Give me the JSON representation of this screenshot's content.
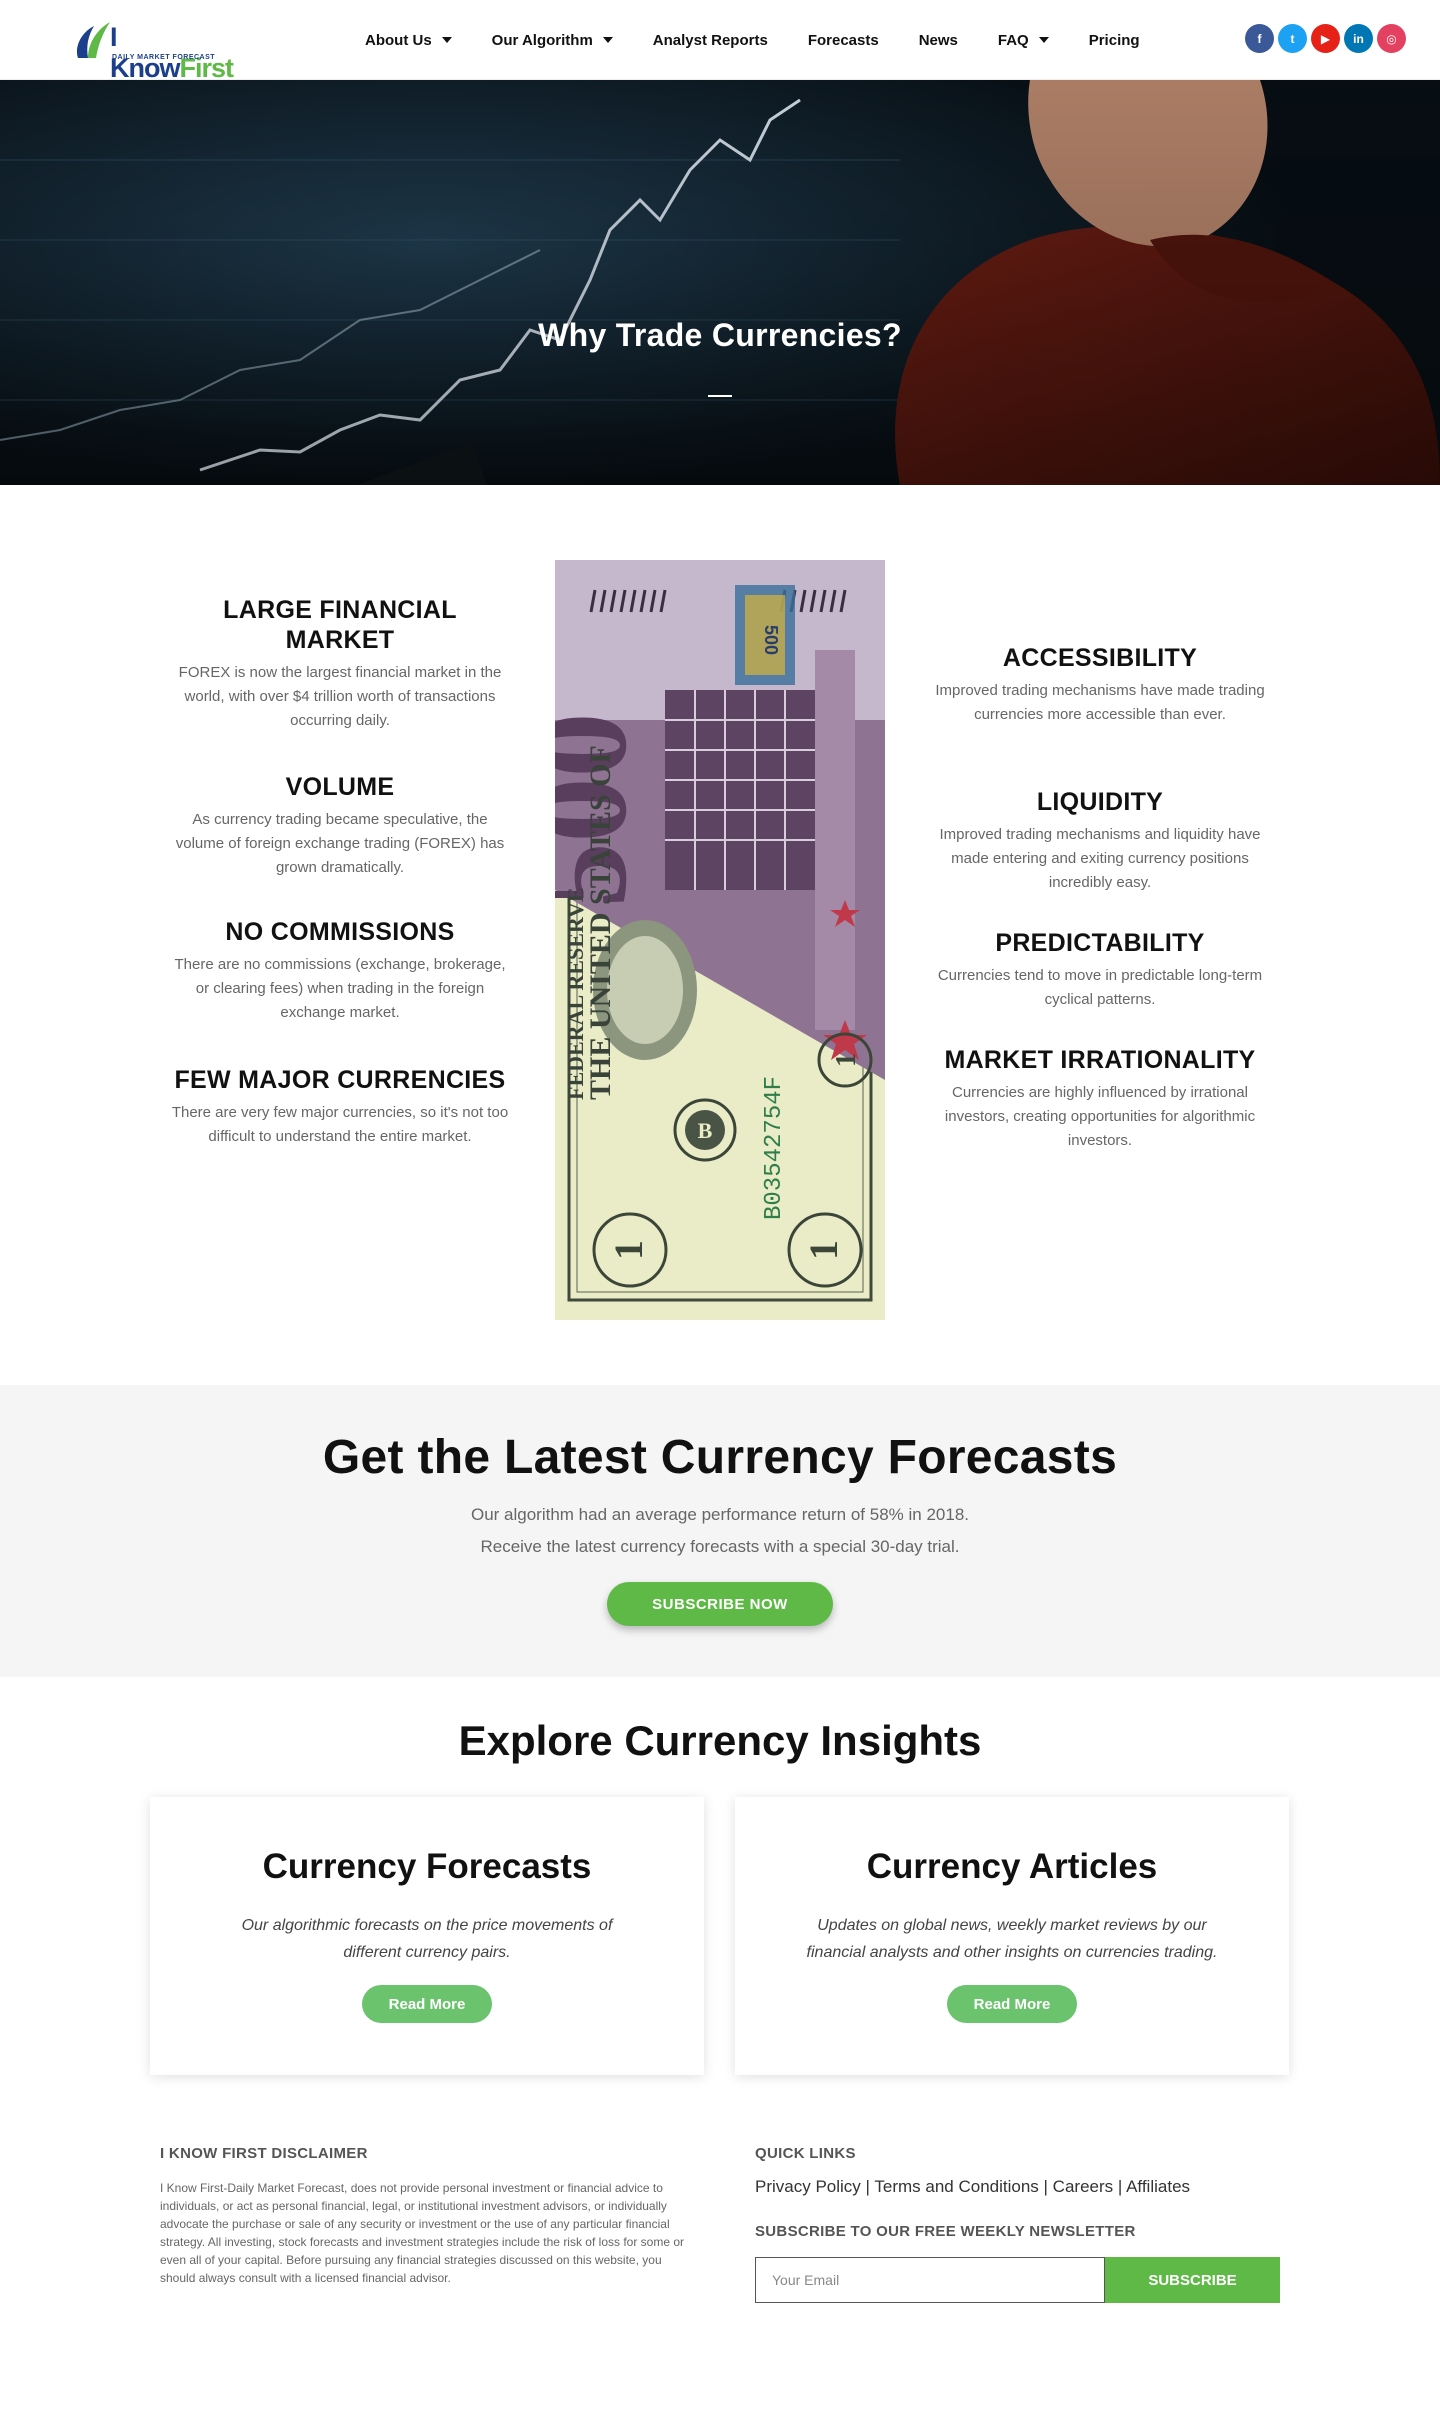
{
  "brand": {
    "name_part1": "I Know",
    "name_part2": "First",
    "tagline": "DAILY MARKET FORECAST"
  },
  "nav": [
    {
      "label": "About Us",
      "dropdown": true
    },
    {
      "label": "Our Algorithm",
      "dropdown": true
    },
    {
      "label": "Analyst Reports",
      "dropdown": false
    },
    {
      "label": "Forecasts",
      "dropdown": false
    },
    {
      "label": "News",
      "dropdown": false
    },
    {
      "label": "FAQ",
      "dropdown": true
    },
    {
      "label": "Pricing",
      "dropdown": false
    }
  ],
  "social": [
    {
      "icon": "facebook-icon",
      "glyph": "f",
      "color": "#3b5998"
    },
    {
      "icon": "twitter-icon",
      "glyph": "t",
      "color": "#1da1f2"
    },
    {
      "icon": "youtube-icon",
      "glyph": "▶",
      "color": "#e62117"
    },
    {
      "icon": "linkedin-icon",
      "glyph": "in",
      "color": "#0077b5"
    },
    {
      "icon": "instagram-icon",
      "glyph": "◎",
      "color": "#e4405f"
    }
  ],
  "hero": {
    "title": "Why Trade Currencies?"
  },
  "why": {
    "left": [
      {
        "title": "LARGE FINANCIAL MARKET",
        "text": "FOREX is now the largest financial market in the world, with over $4 trillion worth of transactions occurring daily."
      },
      {
        "title": "VOLUME",
        "text": "As currency trading became speculative, the volume of foreign exchange trading (FOREX) has grown dramatically."
      },
      {
        "title": "NO COMMISSIONS",
        "text": "There are no commissions (exchange, brokerage, or clearing fees) when trading in the foreign exchange market."
      },
      {
        "title": "FEW MAJOR CURRENCIES",
        "text": "There are very few major currencies, so it's not too difficult to understand the entire market."
      }
    ],
    "right": [
      {
        "title": "ACCESSIBILITY",
        "text": "Improved trading mechanisms have made trading currencies more accessible than ever."
      },
      {
        "title": "LIQUIDITY",
        "text": "Improved trading mechanisms and liquidity have made entering and exiting currency positions incredibly easy."
      },
      {
        "title": "PREDICTABILITY",
        "text": "Currencies tend to move in predictable long-term cyclical patterns."
      },
      {
        "title": "MARKET IRRATIONALITY",
        "text": "Currencies are highly influenced by irrational investors, creating opportunities for algorithmic investors."
      }
    ],
    "bill": {
      "euro_value": "500",
      "dollar_header": "FEDERAL RESERVE",
      "dollar_country": "THE UNITED STATES OF",
      "serial": "B03542754F",
      "seal": "B",
      "digit": "1"
    }
  },
  "latest": {
    "title": "Get the Latest Currency Forecasts",
    "line1": "Our algorithm had an average performance return of 58% in 2018.",
    "line2": "Receive the latest currency forecasts with a special 30-day trial.",
    "button": "SUBSCRIBE NOW"
  },
  "explore": {
    "title": "Explore Currency Insights",
    "cards": [
      {
        "title": "Currency Forecasts",
        "text": "Our algorithmic forecasts on the price movements of different currency pairs.",
        "button": "Read More"
      },
      {
        "title": "Currency Articles",
        "text": "Updates on global news, weekly market reviews by our financial analysts and other insights on currencies trading.",
        "button": "Read More"
      }
    ]
  },
  "footer": {
    "disclaimer_title": "I KNOW FIRST DISCLAIMER",
    "disclaimer_text": "I Know First-Daily Market Forecast, does not provide personal investment or financial advice to individuals, or act as personal financial, legal, or institutional investment advisors, or individually advocate the purchase or sale of any security or investment or the use of any particular financial strategy. All investing, stock forecasts and investment strategies include the risk of loss for some or even all of your capital. Before pursuing any financial strategies discussed on this website, you should always consult with a licensed financial advisor.",
    "quick_links_title": "QUICK LINKS",
    "links": [
      "Privacy Policy",
      "Terms and Conditions",
      "Careers",
      "Affiliates"
    ],
    "link_separator": " | ",
    "newsletter_title": "SUBSCRIBE TO OUR FREE WEEKLY NEWSLETTER",
    "email_placeholder": "Your Email",
    "subscribe_button": "SUBSCRIBE"
  }
}
